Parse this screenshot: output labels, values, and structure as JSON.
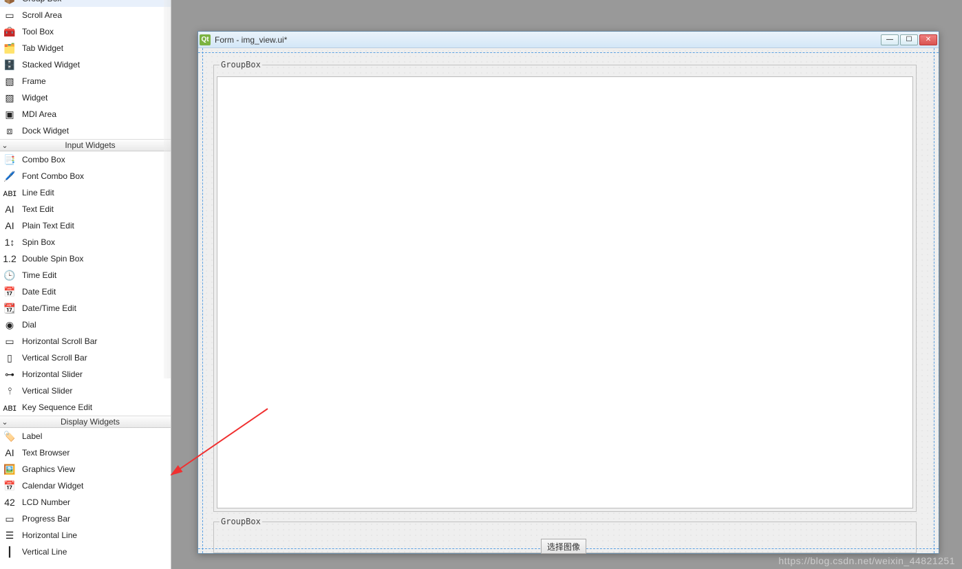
{
  "panel": {
    "containers_items": [
      {
        "icon": "📦",
        "label": "Group Box"
      },
      {
        "icon": "▭",
        "label": "Scroll Area"
      },
      {
        "icon": "🧰",
        "label": "Tool Box"
      },
      {
        "icon": "🗂️",
        "label": "Tab Widget"
      },
      {
        "icon": "🗄️",
        "label": "Stacked Widget"
      },
      {
        "icon": "▧",
        "label": "Frame"
      },
      {
        "icon": "▨",
        "label": "Widget"
      },
      {
        "icon": "▣",
        "label": "MDI Area"
      },
      {
        "icon": "⧈",
        "label": "Dock Widget"
      }
    ],
    "input_header": "Input Widgets",
    "input_items": [
      {
        "icon": "📑",
        "label": "Combo Box"
      },
      {
        "icon": "🖊️",
        "label": "Font Combo Box"
      },
      {
        "icon": "ᴀʙɪ",
        "label": "Line Edit"
      },
      {
        "icon": "AI",
        "label": "Text Edit"
      },
      {
        "icon": "AI",
        "label": "Plain Text Edit"
      },
      {
        "icon": "1↕",
        "label": "Spin Box"
      },
      {
        "icon": "1.2",
        "label": "Double Spin Box"
      },
      {
        "icon": "🕒",
        "label": "Time Edit"
      },
      {
        "icon": "📅",
        "label": "Date Edit"
      },
      {
        "icon": "📆",
        "label": "Date/Time Edit"
      },
      {
        "icon": "◉",
        "label": "Dial"
      },
      {
        "icon": "▭",
        "label": "Horizontal Scroll Bar"
      },
      {
        "icon": "▯",
        "label": "Vertical Scroll Bar"
      },
      {
        "icon": "⊶",
        "label": "Horizontal Slider"
      },
      {
        "icon": "⫯",
        "label": "Vertical Slider"
      },
      {
        "icon": "ᴀʙɪ",
        "label": "Key Sequence Edit"
      }
    ],
    "display_header": "Display Widgets",
    "display_items": [
      {
        "icon": "🏷️",
        "label": "Label"
      },
      {
        "icon": "AI",
        "label": "Text Browser"
      },
      {
        "icon": "🖼️",
        "label": "Graphics View"
      },
      {
        "icon": "📅",
        "label": "Calendar Widget"
      },
      {
        "icon": "42",
        "label": "LCD Number"
      },
      {
        "icon": "▭",
        "label": "Progress Bar"
      },
      {
        "icon": "☰",
        "label": "Horizontal Line"
      },
      {
        "icon": "┃",
        "label": "Vertical Line"
      }
    ]
  },
  "form": {
    "title": "Form - img_view.ui*",
    "groupbox1_title": "GroupBox",
    "groupbox2_title": "GroupBox",
    "button_label": "选择图像"
  },
  "window_controls": {
    "min": "—",
    "max": "☐",
    "close": "✕"
  },
  "watermark": "https://blog.csdn.net/weixin_44821251"
}
